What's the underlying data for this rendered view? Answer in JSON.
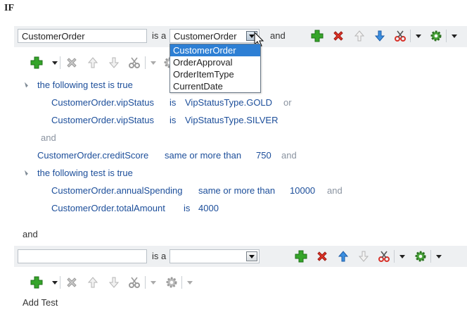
{
  "if_label": "IF",
  "and_between_blocks": "and",
  "add_test": "Add Test",
  "rule1": {
    "left_value": "CustomerOrder",
    "isa": "is a",
    "type_value": "CustomerOrder",
    "and": "and",
    "dropdown": [
      "CustomerOrder",
      "OrderApproval",
      "OrderItemType",
      "CurrentDate"
    ]
  },
  "tests": {
    "group1_label": "the following test is true",
    "g1_row1": {
      "field": "CustomerOrder.vipStatus",
      "op": "is",
      "value": "VipStatusType.GOLD",
      "conj": "or"
    },
    "g1_row2": {
      "field": "CustomerOrder.vipStatus",
      "op": "is",
      "value": "VipStatusType.SILVER"
    },
    "and1": "and",
    "row3": {
      "field": "CustomerOrder.creditScore",
      "op": "same or more than",
      "value": "750",
      "conj": "and"
    },
    "group2_label": "the following test is true",
    "g2_row1": {
      "field": "CustomerOrder.annualSpending",
      "op": "same or more than",
      "value": "10000",
      "conj": "and"
    },
    "g2_row2": {
      "field": "CustomerOrder.totalAmount",
      "op": "is",
      "value": "4000"
    }
  },
  "rule2": {
    "left_value": "",
    "isa": "is a",
    "type_value": ""
  }
}
